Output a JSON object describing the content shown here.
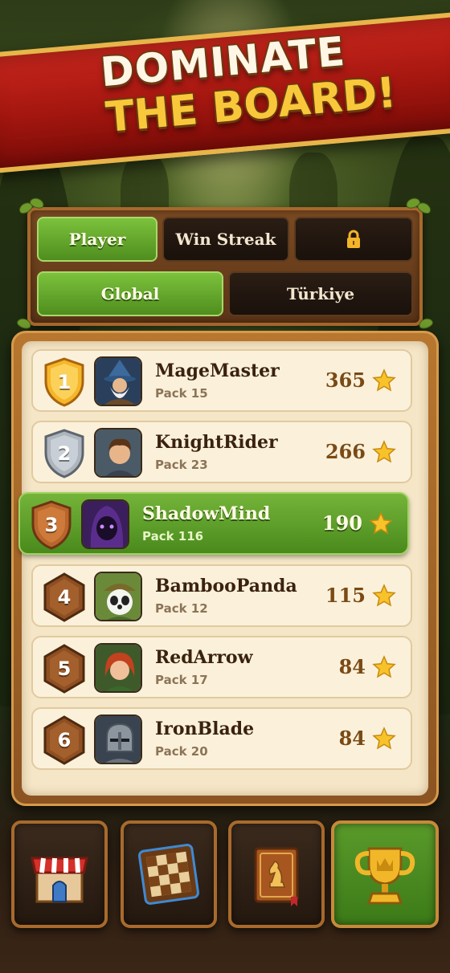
{
  "banner": {
    "line1": "DOMINATE",
    "line2": "THE BOARD!"
  },
  "filters": {
    "row1": [
      {
        "label": "Player",
        "selected": true
      },
      {
        "label": "Win Streak",
        "selected": false
      },
      {
        "label": "",
        "icon": "lock-icon",
        "selected": false
      }
    ],
    "row2": [
      {
        "label": "Global",
        "selected": true
      },
      {
        "label": "Türkiye",
        "selected": false
      }
    ]
  },
  "leaderboard": {
    "rows": [
      {
        "rank": "1",
        "name": "MageMaster",
        "pack": "Pack 15",
        "score": "365",
        "badge": "gold-shield",
        "avatar": "wizard-avatar"
      },
      {
        "rank": "2",
        "name": "KnightRider",
        "pack": "Pack 23",
        "score": "266",
        "badge": "silver-shield",
        "avatar": "boy-avatar"
      },
      {
        "rank": "3",
        "name": "ShadowMind",
        "pack": "Pack 116",
        "score": "190",
        "badge": "bronze-shield",
        "avatar": "hooded-avatar",
        "highlighted": true
      },
      {
        "rank": "4",
        "name": "BambooPanda",
        "pack": "Pack 12",
        "score": "115",
        "badge": "wood-hexagon",
        "avatar": "panda-avatar"
      },
      {
        "rank": "5",
        "name": "RedArrow",
        "pack": "Pack 17",
        "score": "84",
        "badge": "wood-hexagon",
        "avatar": "archer-avatar"
      },
      {
        "rank": "6",
        "name": "IronBlade",
        "pack": "Pack 20",
        "score": "84",
        "badge": "wood-hexagon",
        "avatar": "knight-avatar"
      }
    ],
    "score_icon": "star-icon"
  },
  "bottom_nav": [
    {
      "icon": "shop-icon",
      "active": false
    },
    {
      "icon": "board-icon",
      "active": false
    },
    {
      "icon": "chess-book-icon",
      "active": false
    },
    {
      "icon": "trophy-icon",
      "active": true
    }
  ],
  "colors": {
    "banner_red": "#a3160f",
    "accent_green": "#5fa32a",
    "gold": "#f8c83a",
    "wood": "#8b5322"
  }
}
